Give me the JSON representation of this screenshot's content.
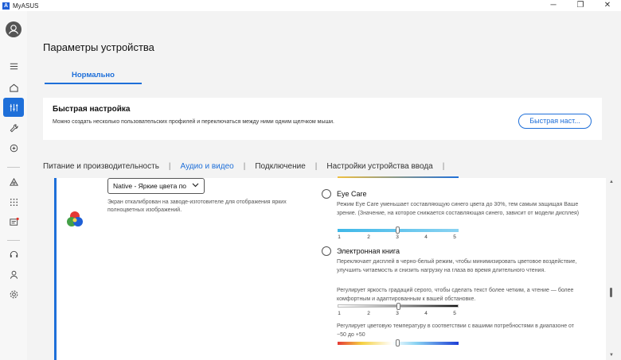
{
  "window": {
    "title": "MyASUS",
    "logo_text": "A",
    "controls": {
      "minimize": "─",
      "maximize": "❐",
      "close": "✕"
    }
  },
  "sidebar": {
    "items": [
      {
        "icon": "avatar-icon"
      },
      {
        "icon": "menu-icon"
      },
      {
        "icon": "home-icon"
      },
      {
        "icon": "customization-icon",
        "active": true
      },
      {
        "icon": "wrench-icon"
      },
      {
        "icon": "sync-icon"
      },
      {
        "icon": "triangle-link-icon"
      },
      {
        "icon": "apps-grid-icon"
      },
      {
        "icon": "message-icon",
        "notification_color": "#e0332b"
      },
      {
        "icon": "headset-icon"
      },
      {
        "icon": "user-icon"
      },
      {
        "icon": "gear-icon"
      }
    ]
  },
  "page": {
    "title": "Параметры устройства",
    "mode_tab": "Нормально"
  },
  "quick_settings": {
    "title": "Быстрая настройка",
    "description": "Можно создать несколько пользовательских профилей и переключаться между ними одним щелчком мыши.",
    "button": "Быстрая наст..."
  },
  "nav": {
    "tabs": [
      {
        "label": "Питание и производительность",
        "active": false
      },
      {
        "label": "Аудио и видео",
        "active": true
      },
      {
        "label": "Подключение",
        "active": false
      },
      {
        "label": "Настройки устройства ввода",
        "active": false
      }
    ],
    "separator": "|"
  },
  "display": {
    "profile_select": "Native - Яркие цвета по",
    "profile_description": "Экран откалиброван на заводе-изготовителе для отображения ярких полноцветных изображений.",
    "eye_care": {
      "title": "Eye Care",
      "description": "Режим Eye Care уменьшает составляющую синего цвета до 30%, тем самым защищая Ваше зрение. (Значение, на которое снижается составляющая синего, зависит от модели дисплея)",
      "slider_level": 3,
      "ticks": [
        "1",
        "2",
        "3",
        "4",
        "5"
      ]
    },
    "ebook": {
      "title": "Электронная книга",
      "description": "Переключает дисплей в черно-белый режим, чтобы минимизировать цветовое воздействие, улучшить читаемость и снизить нагрузку на глаза во время длительного чтения.",
      "gray_description": "Регулирует яркость градаций серого, чтобы сделать текст более четким, а чтение — более комфортным и адаптированным к вашей обстановке.",
      "gray_level": 3,
      "ticks": [
        "1",
        "2",
        "3",
        "4",
        "5"
      ],
      "temp_description": "Регулирует цветовую температуру в соответствии с вашими потребностями в диапазоне от −50 до +50",
      "temp_value": 0
    }
  },
  "colors": {
    "accent": "#1e6fd9",
    "background": "#f3f3f3",
    "panel": "#ffffff"
  }
}
